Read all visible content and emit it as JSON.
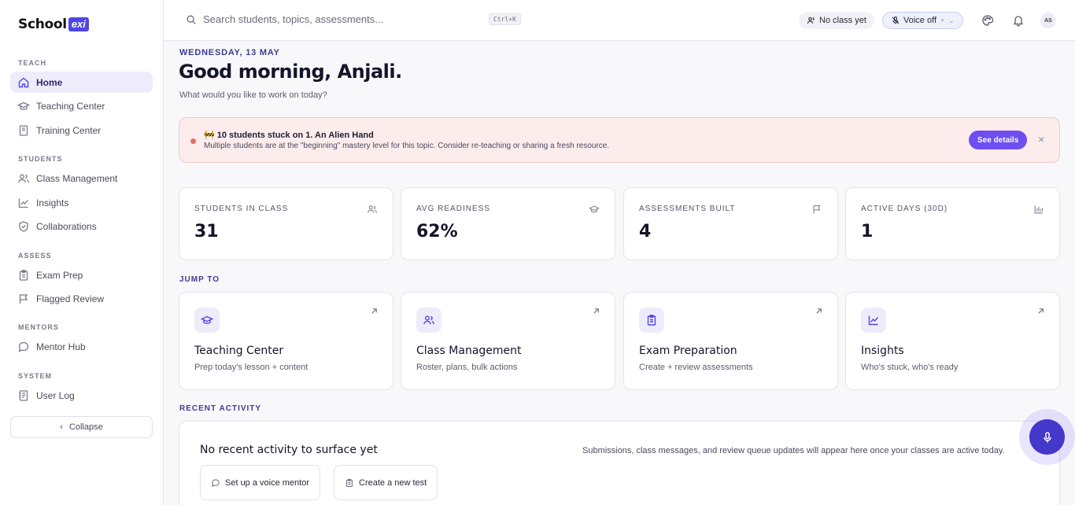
{
  "brand": {
    "name": "School",
    "badge": "exi"
  },
  "sidebar": {
    "sections": [
      {
        "label": "TEACH",
        "items": [
          {
            "label": "Home",
            "icon": "home-icon",
            "active": true
          },
          {
            "label": "Teaching Center",
            "icon": "graduation-cap-icon"
          },
          {
            "label": "Training Center",
            "icon": "book-icon"
          }
        ]
      },
      {
        "label": "STUDENTS",
        "items": [
          {
            "label": "Class Management",
            "icon": "users-icon"
          },
          {
            "label": "Insights",
            "icon": "chart-line-icon"
          },
          {
            "label": "Collaborations",
            "icon": "shield-icon"
          }
        ]
      },
      {
        "label": "ASSESS",
        "items": [
          {
            "label": "Exam Prep",
            "icon": "clipboard-icon"
          },
          {
            "label": "Flagged Review",
            "icon": "flag-icon"
          }
        ]
      },
      {
        "label": "MENTORS",
        "items": [
          {
            "label": "Mentor Hub",
            "icon": "chat-bubble-icon"
          }
        ]
      },
      {
        "label": "SYSTEM",
        "items": [
          {
            "label": "User Log",
            "icon": "log-icon"
          }
        ]
      }
    ],
    "collapse_label": "Collapse"
  },
  "topbar": {
    "search_placeholder": "Search students, topics, assessments...",
    "shortcut": "Ctrl+K",
    "class_pill": "No class yet",
    "voice_pill": "Voice off",
    "voice_dot": "•",
    "avatar_initials": "AS"
  },
  "header": {
    "date": "WEDNESDAY, 13 MAY",
    "greeting": "Good morning, Anjali.",
    "subtitle": "What would you like to work on today?"
  },
  "alert": {
    "title": "🚧 10 students stuck on 1. An Alien Hand",
    "description": "Multiple students are at the \"beginning\" mastery level for this topic. Consider re-teaching or sharing a fresh resource.",
    "action": "See details",
    "close": "×",
    "color": "#ec6b6b"
  },
  "stats": [
    {
      "label": "STUDENTS IN CLASS",
      "value": "31",
      "icon": "users-icon"
    },
    {
      "label": "AVG READINESS",
      "value": "62%",
      "icon": "graduation-cap-icon"
    },
    {
      "label": "ASSESSMENTS BUILT",
      "value": "4",
      "icon": "flag-icon"
    },
    {
      "label": "ACTIVE DAYS (30D)",
      "value": "1",
      "icon": "bar-chart-icon"
    }
  ],
  "jump": {
    "label": "JUMP TO",
    "cards": [
      {
        "title": "Teaching Center",
        "desc": "Prep today's lesson + content",
        "icon": "graduation-cap-icon"
      },
      {
        "title": "Class Management",
        "desc": "Roster, plans, bulk actions",
        "icon": "users-icon"
      },
      {
        "title": "Exam Preparation",
        "desc": "Create + review assessments",
        "icon": "clipboard-icon"
      },
      {
        "title": "Insights",
        "desc": "Who's stuck, who's ready",
        "icon": "chart-line-icon"
      }
    ]
  },
  "activity": {
    "label": "RECENT ACTIVITY",
    "title": "No recent activity to surface yet",
    "description": "Submissions, class messages, and review queue updates will appear here once your classes are active today.",
    "buttons": [
      {
        "label": "Set up a voice mentor",
        "icon": "chat-bubble-icon"
      },
      {
        "label": "Create a new test",
        "icon": "clipboard-icon"
      }
    ]
  },
  "colors": {
    "accent": "#4f46e5",
    "accent_bg": "#eeecfb",
    "alert_bg": "#fdecec",
    "button": "#6d4ef0"
  }
}
